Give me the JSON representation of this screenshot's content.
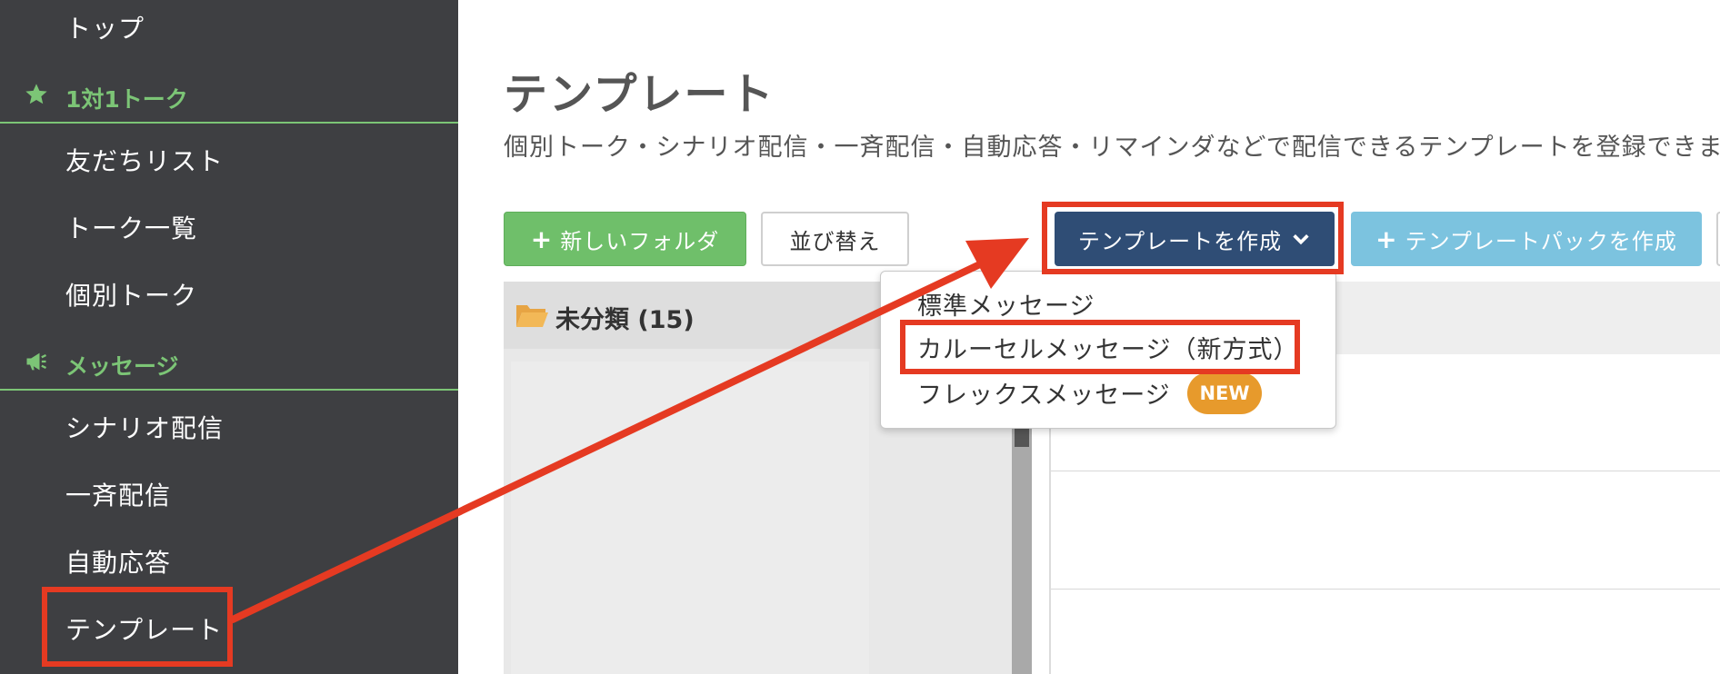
{
  "sidebar": {
    "top": "トップ",
    "section1": {
      "label": "1対1トーク",
      "icon": "star-icon"
    },
    "friends": "友だちリスト",
    "talk_list": "トーク一覧",
    "individual": "個別トーク",
    "section2": {
      "label": "メッセージ",
      "icon": "megaphone-icon"
    },
    "scenario": "シナリオ配信",
    "broadcast": "一斉配信",
    "auto_reply": "自動応答",
    "template": "テンプレート"
  },
  "main": {
    "title": "テンプレート",
    "description": "個別トーク・シナリオ配信・一斉配信・自動応答・リマインダなどで配信できるテンプレートを登録できま",
    "buttons": {
      "new_folder": "新しいフォルダ",
      "sort": "並び替え",
      "create_template": "テンプレートを作成",
      "create_pack": "テンプレートパックを作成"
    },
    "folder": {
      "name": "未分類 (15)"
    },
    "dropdown": {
      "items": [
        "標準メッセージ",
        "カルーセルメッセージ（新方式）",
        "フレックスメッセージ"
      ],
      "badge": "NEW"
    }
  },
  "colors": {
    "sidebar_bg": "#3e3f42",
    "accent_green": "#7cc576",
    "navy": "#2f4d75",
    "sky": "#7cc3df",
    "highlight_red": "#e53a22",
    "badge_orange": "#e79a2c"
  }
}
